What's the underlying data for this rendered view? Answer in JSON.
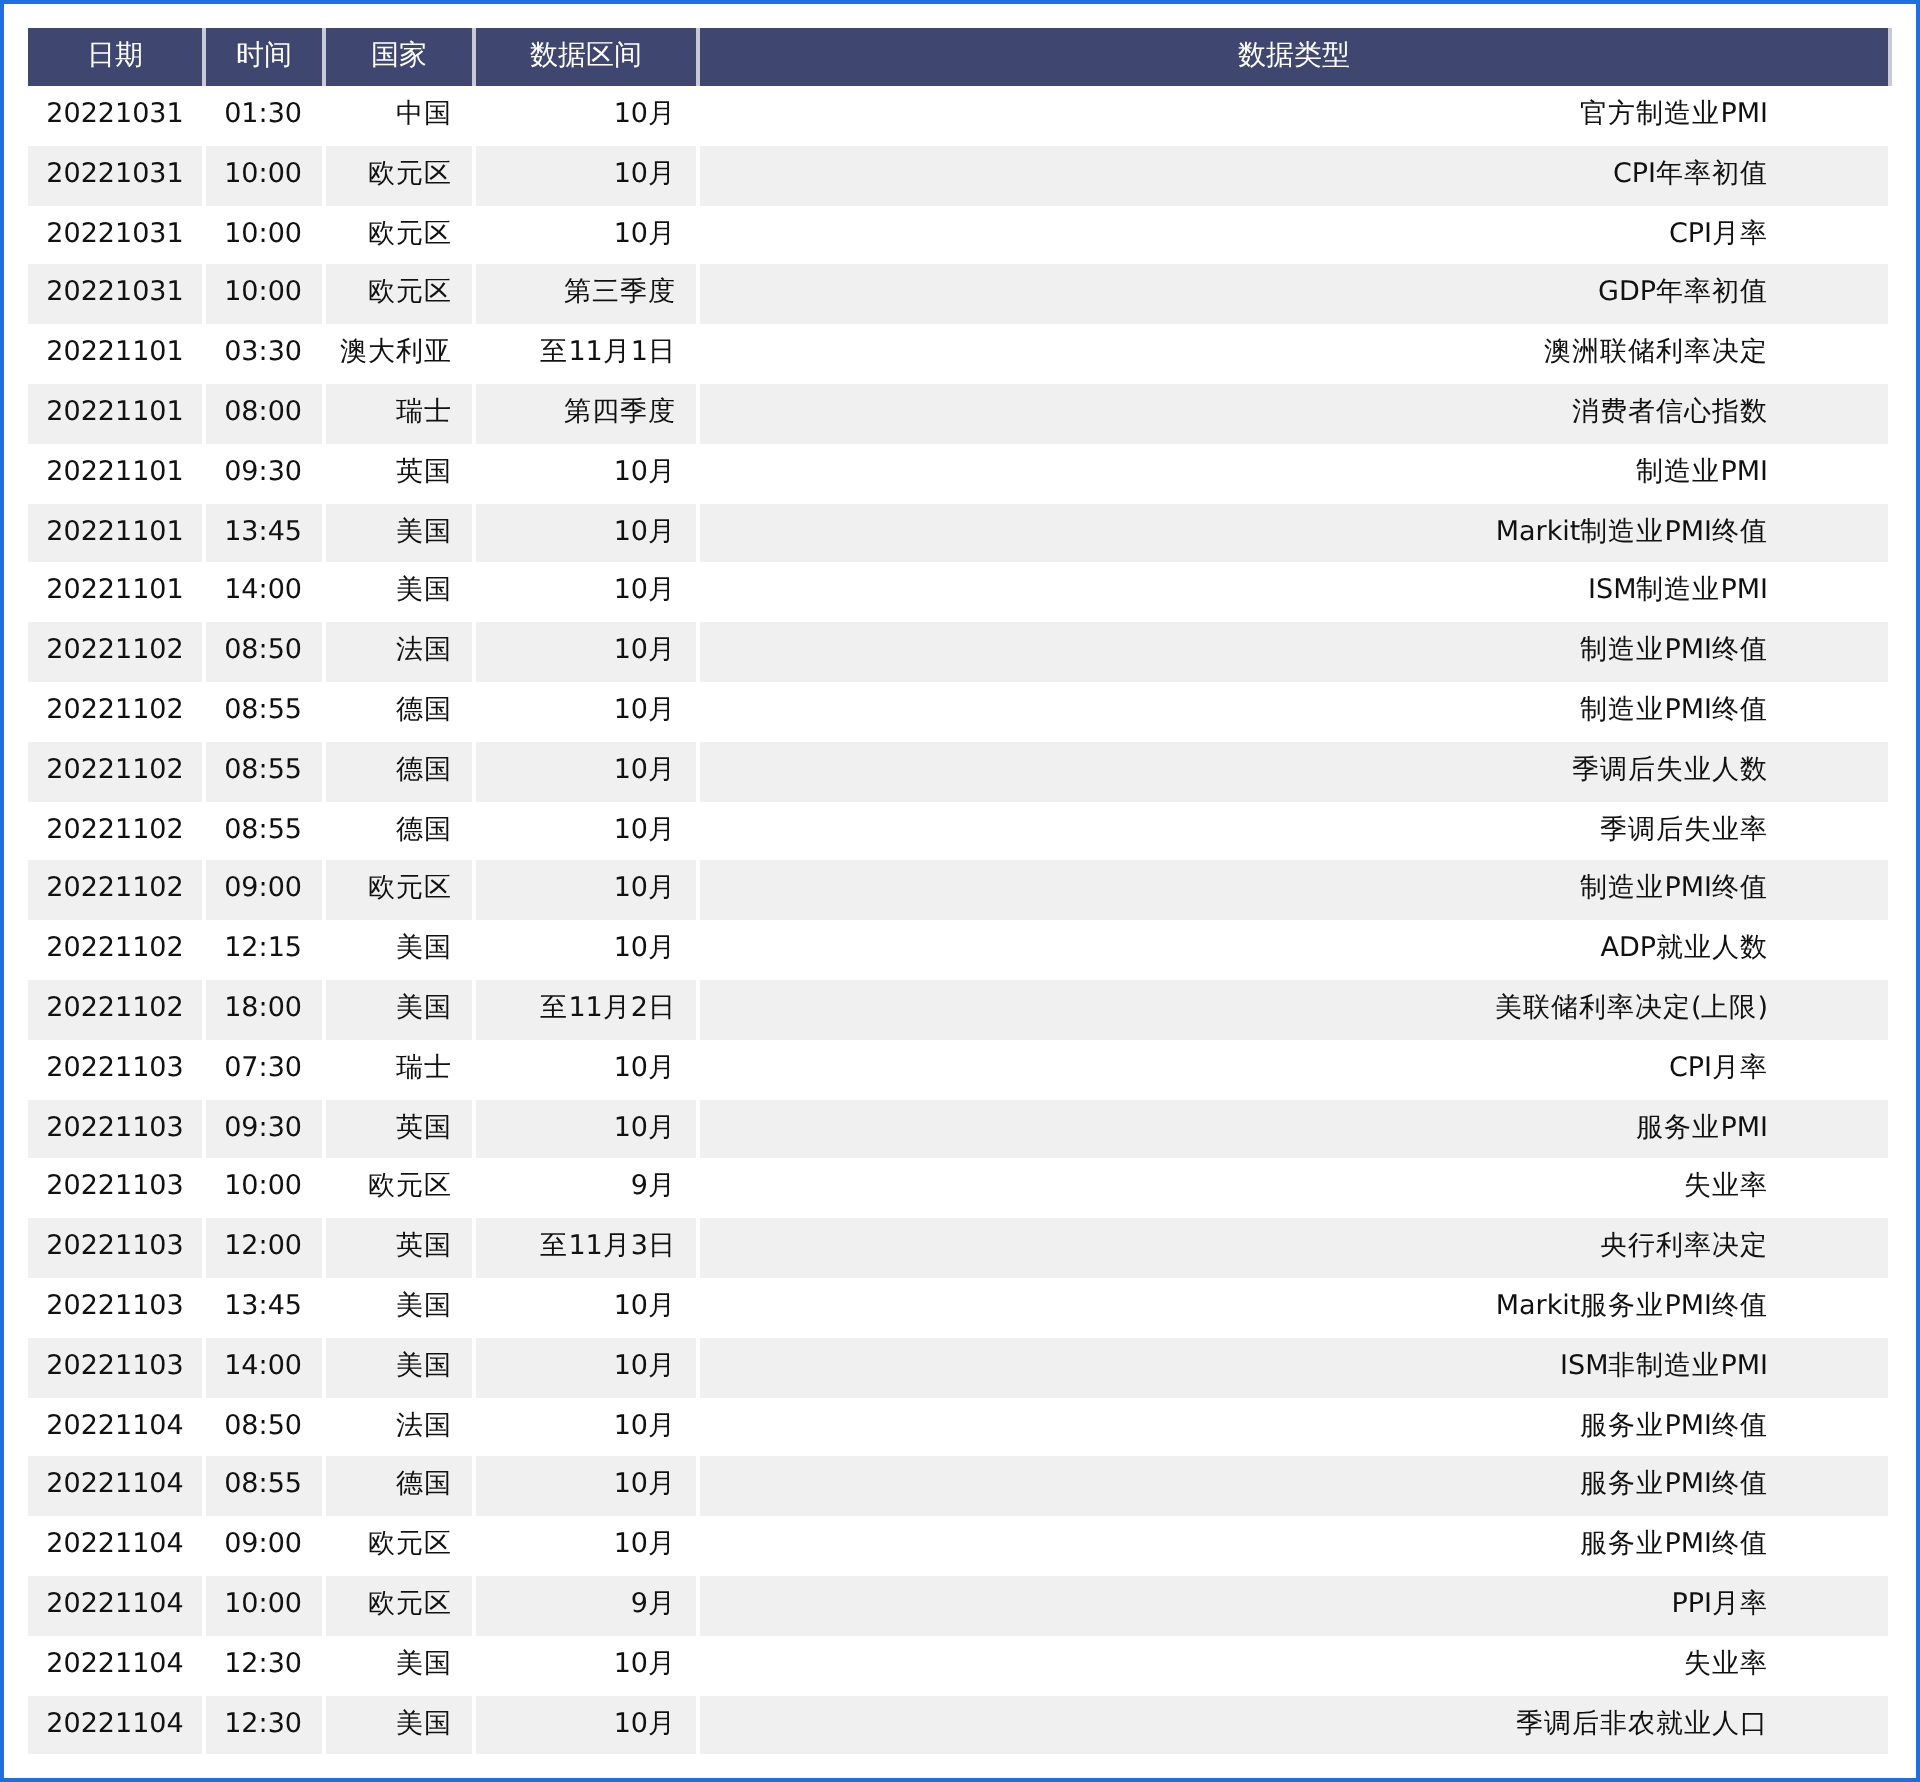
{
  "table": {
    "columns": [
      "日期",
      "时间",
      "国家",
      "数据区间",
      "数据类型"
    ],
    "rows": [
      [
        "20221031",
        "01:30",
        "中国",
        "10月",
        "官方制造业PMI"
      ],
      [
        "20221031",
        "10:00",
        "欧元区",
        "10月",
        "CPI年率初值"
      ],
      [
        "20221031",
        "10:00",
        "欧元区",
        "10月",
        "CPI月率"
      ],
      [
        "20221031",
        "10:00",
        "欧元区",
        "第三季度",
        "GDP年率初值"
      ],
      [
        "20221101",
        "03:30",
        "澳大利亚",
        "至11月1日",
        "澳洲联储利率决定"
      ],
      [
        "20221101",
        "08:00",
        "瑞士",
        "第四季度",
        "消费者信心指数"
      ],
      [
        "20221101",
        "09:30",
        "英国",
        "10月",
        "制造业PMI"
      ],
      [
        "20221101",
        "13:45",
        "美国",
        "10月",
        "Markit制造业PMI终值"
      ],
      [
        "20221101",
        "14:00",
        "美国",
        "10月",
        "ISM制造业PMI"
      ],
      [
        "20221102",
        "08:50",
        "法国",
        "10月",
        "制造业PMI终值"
      ],
      [
        "20221102",
        "08:55",
        "德国",
        "10月",
        "制造业PMI终值"
      ],
      [
        "20221102",
        "08:55",
        "德国",
        "10月",
        "季调后失业人数"
      ],
      [
        "20221102",
        "08:55",
        "德国",
        "10月",
        "季调后失业率"
      ],
      [
        "20221102",
        "09:00",
        "欧元区",
        "10月",
        "制造业PMI终值"
      ],
      [
        "20221102",
        "12:15",
        "美国",
        "10月",
        "ADP就业人数"
      ],
      [
        "20221102",
        "18:00",
        "美国",
        "至11月2日",
        "美联储利率决定(上限)"
      ],
      [
        "20221103",
        "07:30",
        "瑞士",
        "10月",
        "CPI月率"
      ],
      [
        "20221103",
        "09:30",
        "英国",
        "10月",
        "服务业PMI"
      ],
      [
        "20221103",
        "10:00",
        "欧元区",
        "9月",
        "失业率"
      ],
      [
        "20221103",
        "12:00",
        "英国",
        "至11月3日",
        "央行利率决定"
      ],
      [
        "20221103",
        "13:45",
        "美国",
        "10月",
        "Markit服务业PMI终值"
      ],
      [
        "20221103",
        "14:00",
        "美国",
        "10月",
        "ISM非制造业PMI"
      ],
      [
        "20221104",
        "08:50",
        "法国",
        "10月",
        "服务业PMI终值"
      ],
      [
        "20221104",
        "08:55",
        "德国",
        "10月",
        "服务业PMI终值"
      ],
      [
        "20221104",
        "09:00",
        "欧元区",
        "10月",
        "服务业PMI终值"
      ],
      [
        "20221104",
        "10:00",
        "欧元区",
        "9月",
        "PPI月率"
      ],
      [
        "20221104",
        "12:30",
        "美国",
        "10月",
        "失业率"
      ],
      [
        "20221104",
        "12:30",
        "美国",
        "10月",
        "季调后非农就业人口"
      ]
    ]
  }
}
